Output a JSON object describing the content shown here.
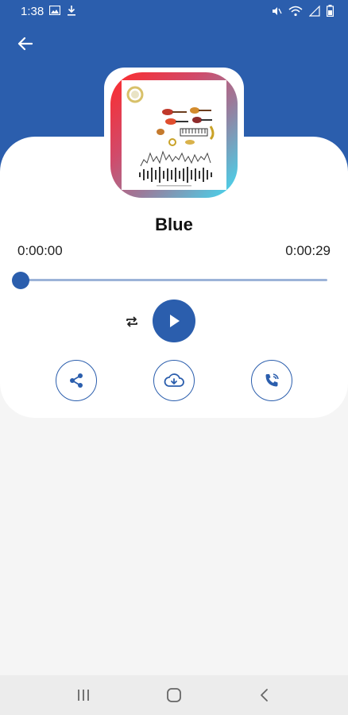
{
  "status_bar": {
    "time": "1:38",
    "left_icons": [
      "image-icon",
      "download-icon"
    ],
    "right_icons": [
      "mute-icon",
      "wifi-icon",
      "signal-icon",
      "battery-icon"
    ]
  },
  "header": {
    "back_icon": "arrow-left-icon"
  },
  "track": {
    "title": "Blue",
    "current_time": "0:00:00",
    "total_time": "0:00:29",
    "progress": 0
  },
  "controls": {
    "repeat_icon": "repeat-icon",
    "play_icon": "play-icon"
  },
  "actions": [
    {
      "name": "share",
      "icon": "share-icon"
    },
    {
      "name": "download",
      "icon": "cloud-download-icon"
    },
    {
      "name": "set-ringtone",
      "icon": "phone-ringtone-icon"
    }
  ],
  "colors": {
    "primary": "#2b5ead",
    "track_light": "#9cb3d8",
    "background": "#f5f5f5",
    "card": "#ffffff"
  },
  "nav_bar": {
    "buttons": [
      "recents-icon",
      "home-icon",
      "back-icon"
    ]
  }
}
